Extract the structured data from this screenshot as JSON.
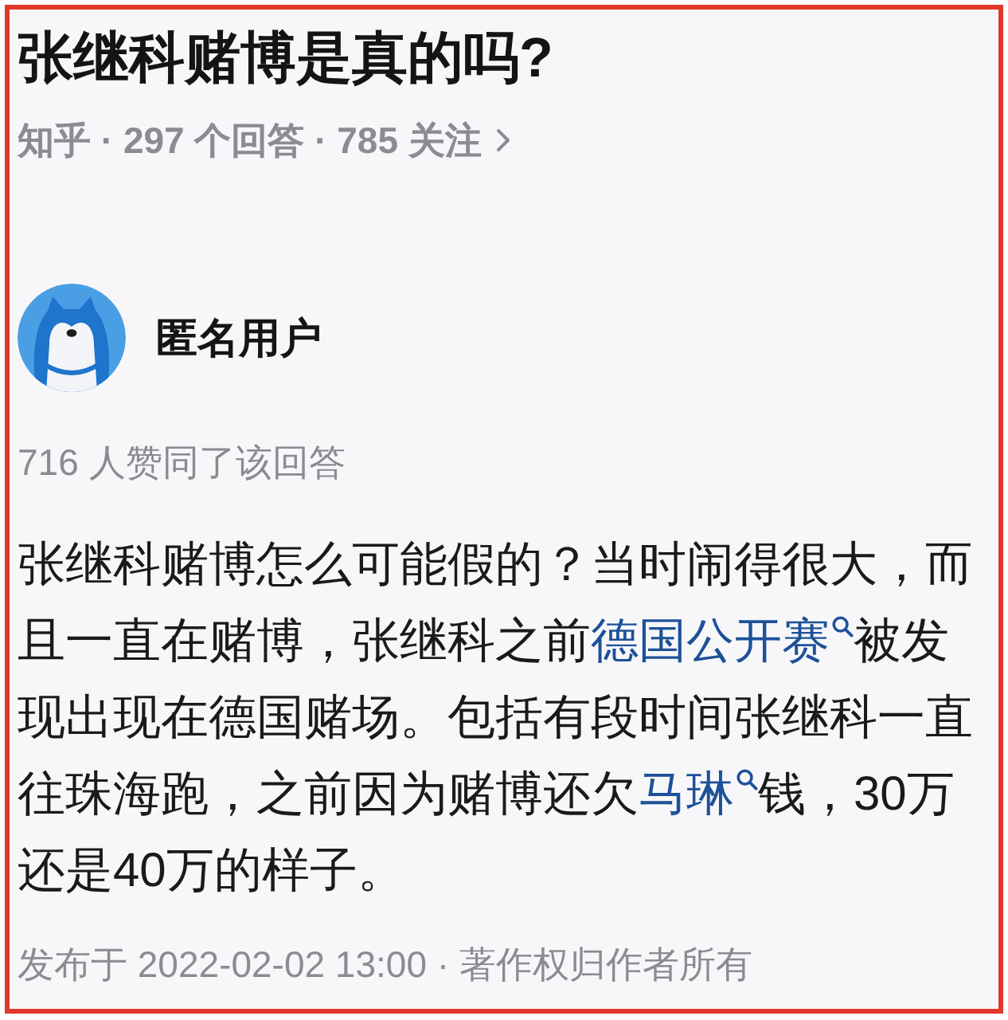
{
  "question": {
    "title": "张继科赌博是真的吗?",
    "meta": "知乎 · 297 个回答 · 785 关注"
  },
  "answer": {
    "author": "匿名用户",
    "upvotes": "716 人赞同了该回答",
    "body": [
      {
        "kind": "text",
        "text": "张继科赌博怎么可能假的？当时闹得很大，而且一直在赌博，张继科之前"
      },
      {
        "kind": "link",
        "text": "德国公开赛"
      },
      {
        "kind": "text",
        "text": "被发现出现在德国赌场。包括有段时间张继科一直往珠海跑，之前因为赌博还欠"
      },
      {
        "kind": "link",
        "text": "马琳"
      },
      {
        "kind": "text",
        "text": "钱，30万还是40万的样子。"
      }
    ],
    "footer": "发布于 2022-02-02 13:00 · 著作权归作者所有"
  }
}
